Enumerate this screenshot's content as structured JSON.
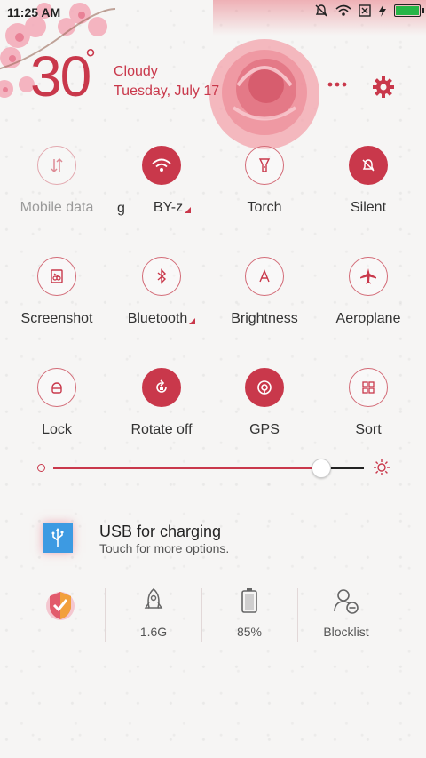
{
  "status": {
    "time": "11:25 AM",
    "battery_level": 0.92
  },
  "weather": {
    "temperature": "30",
    "degree_symbol": "°",
    "condition": "Cloudy",
    "date": "Tuesday, July 17"
  },
  "header": {
    "more_icon": "more-dots-icon",
    "settings_icon": "gear-icon"
  },
  "tiles": [
    {
      "label": "Mobile data",
      "icon": "mobile-data-icon",
      "active": false,
      "dim": true
    },
    {
      "label": "BY-z",
      "icon": "wifi-icon",
      "active": true,
      "submenu": true,
      "partial": "g"
    },
    {
      "label": "Torch",
      "icon": "torch-icon",
      "active": false
    },
    {
      "label": "Silent",
      "icon": "bell-off-icon",
      "active": true
    },
    {
      "label": "Screenshot",
      "icon": "screenshot-icon",
      "active": false
    },
    {
      "label": "Bluetooth",
      "icon": "bluetooth-icon",
      "active": false,
      "submenu": true
    },
    {
      "label": "Brightness",
      "icon": "brightness-auto-icon",
      "active": false
    },
    {
      "label": "Aeroplane",
      "icon": "airplane-icon",
      "active": false
    },
    {
      "label": "Lock",
      "icon": "lock-icon",
      "active": false
    },
    {
      "label": "Rotate off",
      "icon": "rotate-lock-icon",
      "active": true
    },
    {
      "label": "GPS",
      "icon": "gps-icon",
      "active": true
    },
    {
      "label": "Sort",
      "icon": "sort-grid-icon",
      "active": false
    }
  ],
  "brightness": {
    "level": 0.86
  },
  "usb": {
    "title": "USB for charging",
    "subtitle": "Touch for more options.",
    "icon": "usb-icon"
  },
  "bottom": [
    {
      "label": "",
      "icon": "security-shield-icon"
    },
    {
      "label": "1.6G",
      "icon": "rocket-icon"
    },
    {
      "label": "85%",
      "icon": "battery-icon"
    },
    {
      "label": "Blocklist",
      "icon": "blocklist-user-icon"
    }
  ],
  "colors": {
    "accent": "#c9384b",
    "text": "#333333",
    "usb_blue": "#3d9ae2"
  }
}
